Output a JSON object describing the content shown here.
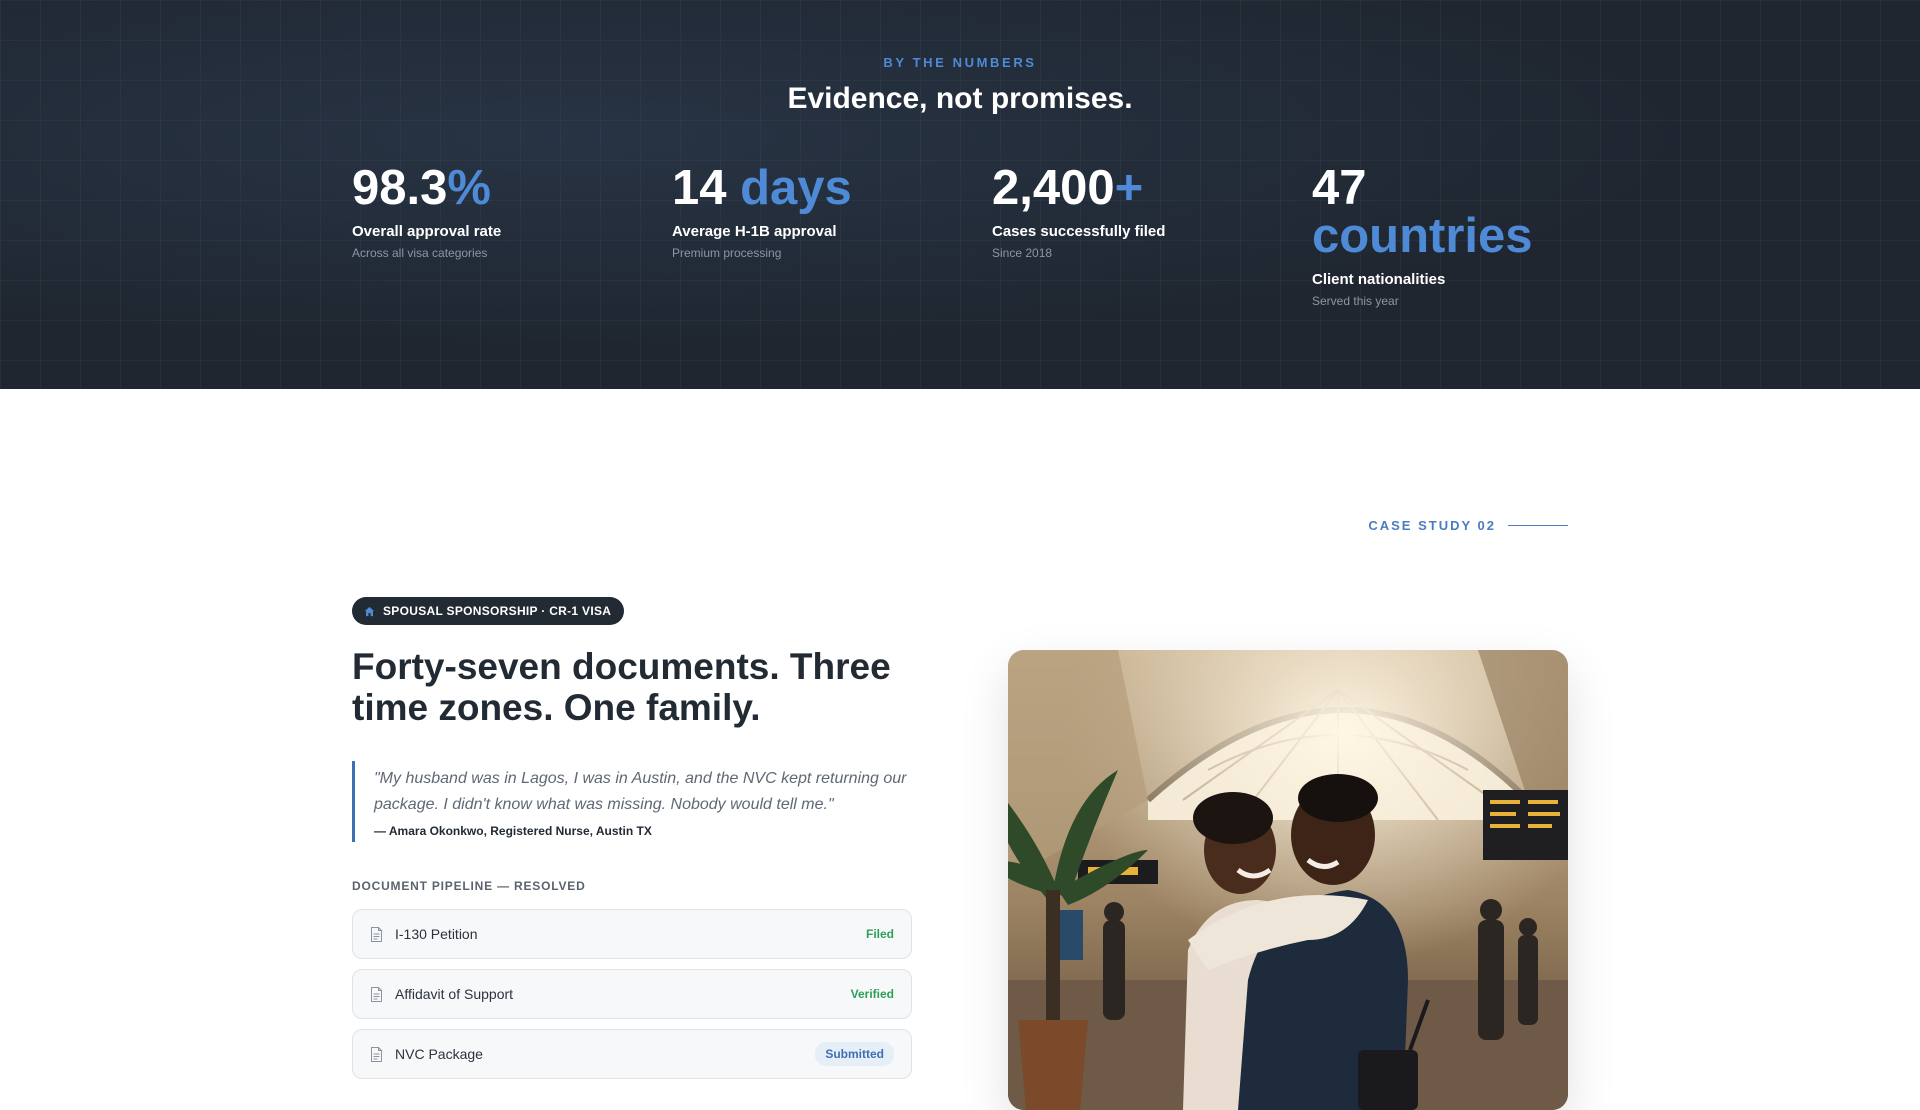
{
  "numbers": {
    "eyebrow": "BY THE NUMBERS",
    "title": "Evidence, not promises.",
    "stats": [
      {
        "value": "98.3",
        "accent": "%",
        "label": "Overall approval rate",
        "sub": "Across all visa categories"
      },
      {
        "value": "14 ",
        "accent": "days",
        "label": "Average H-1B approval",
        "sub": "Premium processing"
      },
      {
        "value": "2,400",
        "accent": "+",
        "label": "Cases successfully filed",
        "sub": "Since 2018"
      },
      {
        "value": "47",
        "accent": "countries",
        "label": "Client nationalities",
        "sub": "Served this year"
      }
    ]
  },
  "case_study": {
    "eyebrow": "CASE STUDY 02",
    "pill": {
      "icon": "home-icon",
      "label": "SPOUSAL SPONSORSHIP · CR-1 VISA"
    },
    "headline": "Forty-seven documents. Three time zones. One family.",
    "quote": "\"My husband was in Lagos, I was in Austin, and the NVC kept returning our package. I didn't know what was missing. Nobody would tell me.\"",
    "attribution": "— Amara Okonkwo, Registered Nurse, Austin TX",
    "pipeline_title": "DOCUMENT PIPELINE — RESOLVED",
    "documents": [
      {
        "icon": "document-icon",
        "name": "I-130 Petition",
        "status": "Filed"
      },
      {
        "icon": "document-icon",
        "name": "Affidavit of Support",
        "status": "Verified"
      },
      {
        "icon": "document-icon",
        "name": "NVC Package",
        "status": "Submitted"
      }
    ],
    "photo": {
      "icon": "reunion-photo",
      "alt": "Couple embracing in an airport terminal"
    }
  },
  "colors": {
    "accent": "#4f8ad6",
    "dark": "#1f2630",
    "success": "#2f9e58",
    "info": "#3f6fb3"
  }
}
